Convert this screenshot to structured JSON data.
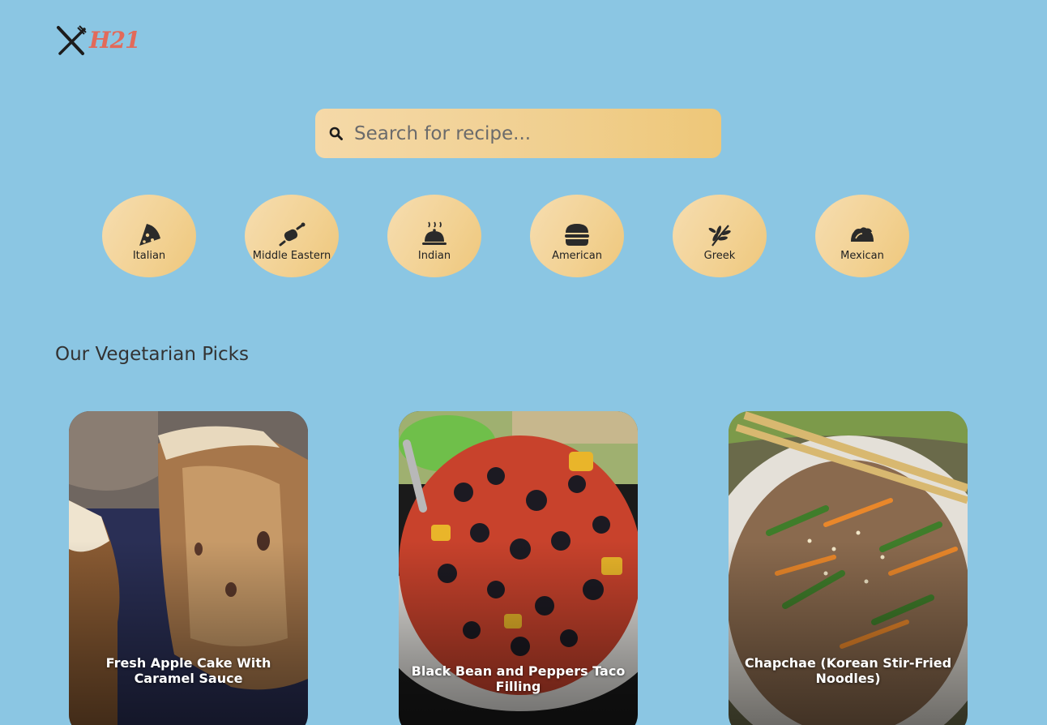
{
  "brand": {
    "logo_text": "H21",
    "icon": "fork-knife-icon"
  },
  "search": {
    "placeholder": "Search for recipe...",
    "value": "",
    "icon": "search-icon"
  },
  "categories": [
    {
      "label": "Italian",
      "icon": "pizza-icon"
    },
    {
      "label": "Middle Eastern",
      "icon": "kebab-icon"
    },
    {
      "label": "Indian",
      "icon": "cloche-icon"
    },
    {
      "label": "American",
      "icon": "burger-icon"
    },
    {
      "label": "Greek",
      "icon": "olive-branch-icon"
    },
    {
      "label": "Mexican",
      "icon": "taco-icon"
    }
  ],
  "section": {
    "title": "Our Vegetarian Picks"
  },
  "recipes": [
    {
      "title": "Fresh Apple Cake With Caramel Sauce"
    },
    {
      "title": "Black Bean and Peppers Taco Filling"
    },
    {
      "title": "Chapchae (Korean Stir-Fried Noodles)"
    }
  ],
  "colors": {
    "background": "#8bc6e3",
    "accent": "#f0cf8f",
    "logo": "#e26a5a"
  }
}
